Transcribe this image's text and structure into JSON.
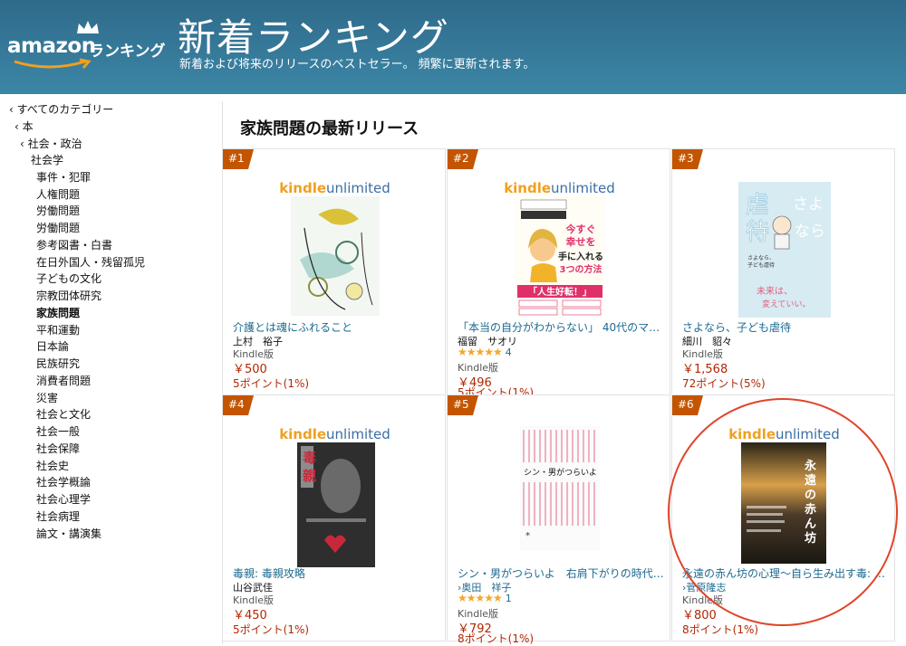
{
  "header": {
    "logo_amazon": "amazon",
    "logo_ranking": "ランキング",
    "title": "新着ランキング",
    "subtitle": "新着および将来のリリースのベストセラー。 頻繁に更新されます。"
  },
  "sidebar": {
    "all_categories": "‹ すべてのカテゴリー",
    "books": "‹ 本",
    "society_politics": "‹ 社会・政治",
    "sociology": "社会学",
    "items": [
      "事件・犯罪",
      "人権問題",
      "労働問題",
      "労働問題",
      "参考図書・白書",
      "在日外国人・残留孤児",
      "子どもの文化",
      "宗教団体研究",
      "家族問題",
      "平和運動",
      "日本論",
      "民族研究",
      "消費者問題",
      "災害",
      "社会と文化",
      "社会一般",
      "社会保障",
      "社会史",
      "社会学概論",
      "社会心理学",
      "社会病理",
      "論文・講演集"
    ],
    "selected": "家族問題"
  },
  "main": {
    "heading": "家族問題の最新リリース",
    "ku_kindle": "kindle",
    "ku_unlimited": "unlimited",
    "products": [
      {
        "rank": "#1",
        "title": "介護とは魂にふれること",
        "author": "上村　裕子",
        "author_link": false,
        "stars": "",
        "reviews": "",
        "format": "Kindle版",
        "price": "￥500",
        "points": "5ポイント(1%)",
        "ku": true,
        "cover_text": "介護とは魂にふれること"
      },
      {
        "rank": "#2",
        "title": "「本当の自分がわからない」 40代のママが …",
        "author": "福留　サオリ",
        "author_link": false,
        "stars": "★★★★★",
        "reviews": "4",
        "format": "Kindle版",
        "price": "￥496",
        "points": "5ポイント(1%)",
        "ku": true,
        "cover_text": "今すぐ幸せを手に入れる3つの方法",
        "cover_banner": "「人生好転！」"
      },
      {
        "rank": "#3",
        "title": "さよなら、子ども虐待",
        "author": "細川　貂々",
        "author_link": false,
        "stars": "",
        "reviews": "",
        "format": "Kindle版",
        "price": "￥1,568",
        "points": "72ポイント(5%)",
        "ku": false,
        "cover_text": "さよなら、子ども虐待"
      },
      {
        "rank": "#4",
        "title": "毒親: 毒親攻略",
        "author": "山谷武佳",
        "author_link": false,
        "stars": "",
        "reviews": "",
        "format": "Kindle版",
        "price": "￥450",
        "points": "5ポイント(1%)",
        "ku": true,
        "cover_text": "毒親"
      },
      {
        "rank": "#5",
        "title": "シン・男がつらいよ　右肩下がりの時代の男…",
        "author": "›奥田　祥子",
        "author_link": true,
        "stars": "★★★★★",
        "reviews": "1",
        "format": "Kindle版",
        "price": "￥792",
        "points": "8ポイント(1%)",
        "ku": false,
        "cover_text": "シン・男がつらいよ"
      },
      {
        "rank": "#6",
        "title": "永遠の赤ん坊の心理〜自ら生み出す毒: 感謝…",
        "author": "›菅原隆志",
        "author_link": true,
        "stars": "",
        "reviews": "",
        "format": "Kindle版",
        "price": "￥800",
        "points": "8ポイント(1%)",
        "ku": true,
        "cover_text": "永遠の赤ん坊"
      }
    ]
  },
  "colors": {
    "header": "#3c86a6",
    "price": "#b12704",
    "link": "#1c6a90",
    "badge": "#c45500",
    "highlight": "#e0452a"
  }
}
